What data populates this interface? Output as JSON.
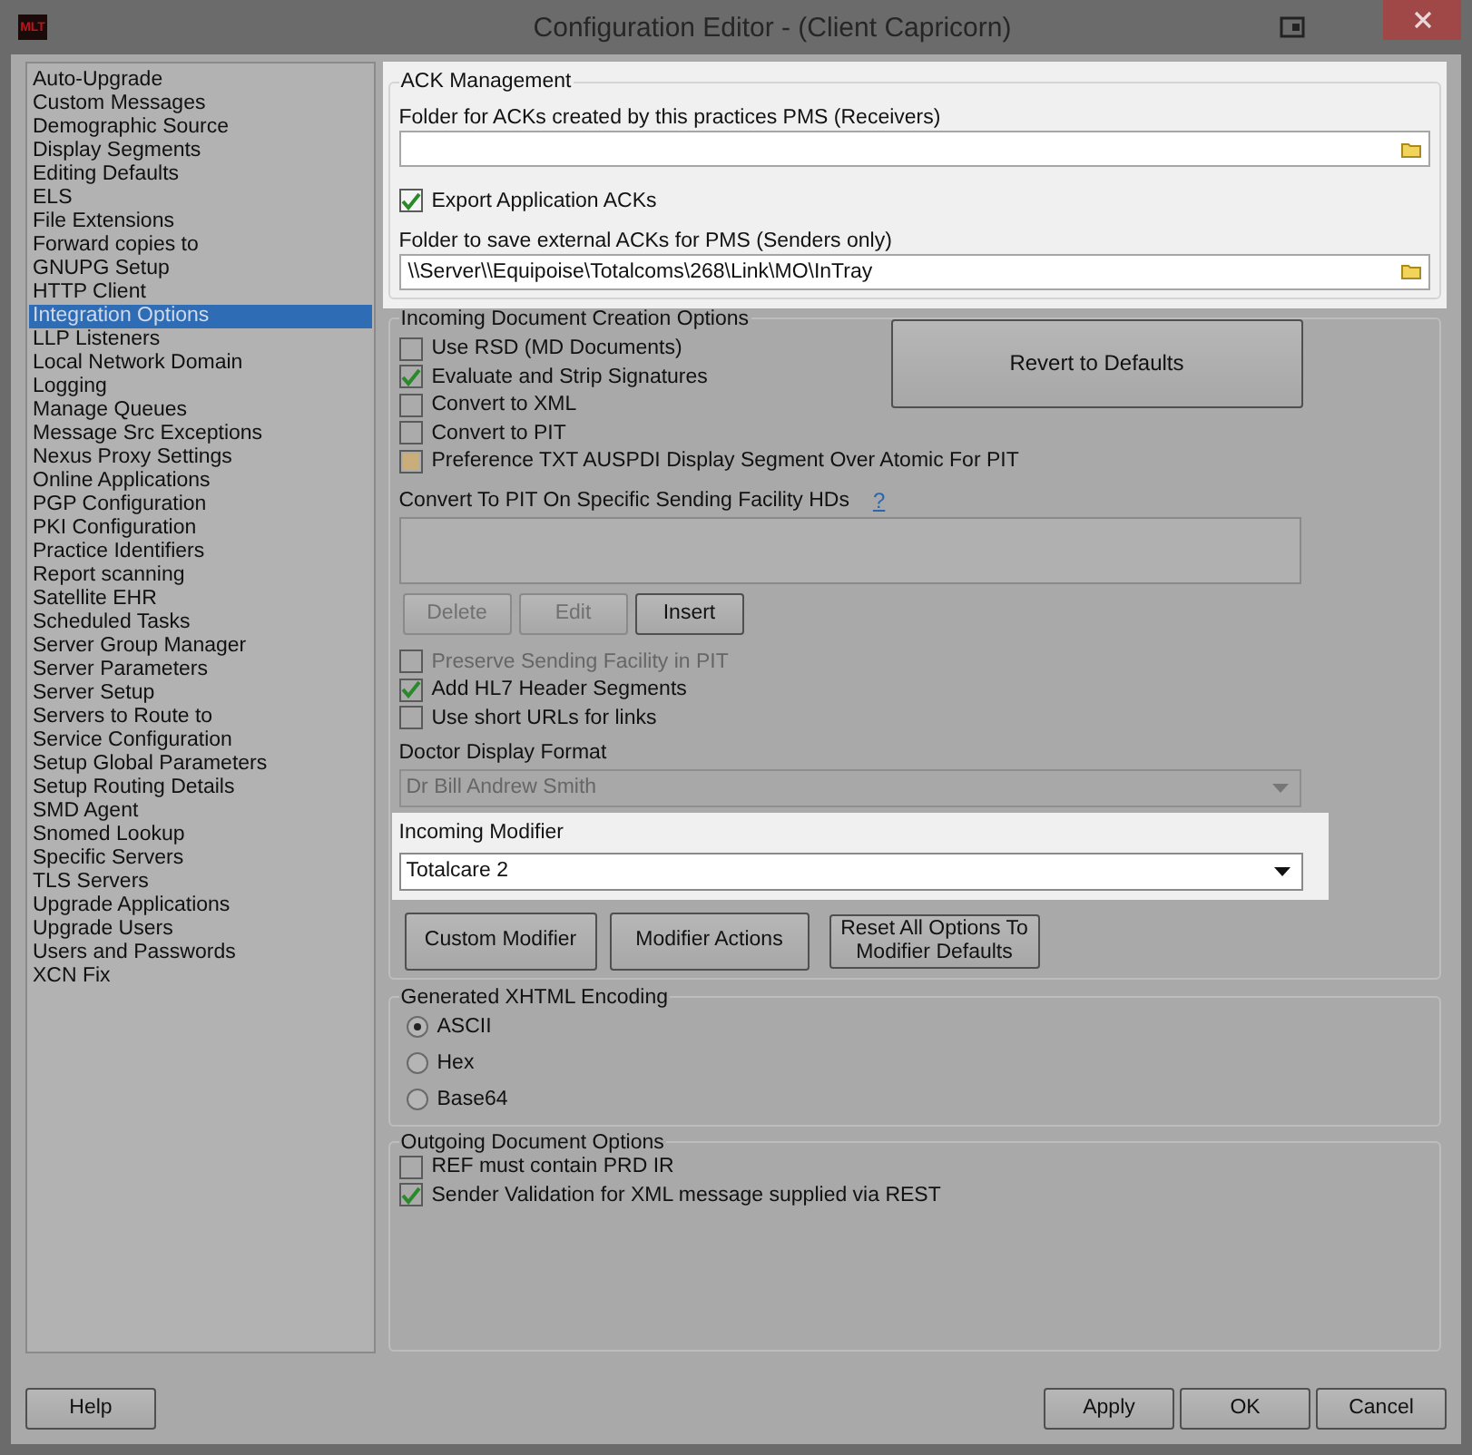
{
  "window": {
    "logo": "MLT",
    "title": "Configuration Editor -  (Client Capricorn)"
  },
  "sidebar": {
    "items": [
      {
        "label": "Auto-Upgrade",
        "selected": false
      },
      {
        "label": "Custom Messages",
        "selected": false
      },
      {
        "label": "Demographic Source",
        "selected": false
      },
      {
        "label": "Display Segments",
        "selected": false
      },
      {
        "label": "Editing Defaults",
        "selected": false
      },
      {
        "label": "ELS",
        "selected": false
      },
      {
        "label": "File Extensions",
        "selected": false
      },
      {
        "label": "Forward copies to",
        "selected": false
      },
      {
        "label": "GNUPG Setup",
        "selected": false
      },
      {
        "label": "HTTP Client",
        "selected": false
      },
      {
        "label": "Integration Options",
        "selected": true
      },
      {
        "label": "LLP Listeners",
        "selected": false
      },
      {
        "label": "Local Network Domain",
        "selected": false
      },
      {
        "label": "Logging",
        "selected": false
      },
      {
        "label": "Manage Queues",
        "selected": false
      },
      {
        "label": "Message Src Exceptions",
        "selected": false
      },
      {
        "label": "Nexus Proxy Settings",
        "selected": false
      },
      {
        "label": "Online Applications",
        "selected": false
      },
      {
        "label": "PGP Configuration",
        "selected": false
      },
      {
        "label": "PKI Configuration",
        "selected": false
      },
      {
        "label": "Practice Identifiers",
        "selected": false
      },
      {
        "label": "Report scanning",
        "selected": false
      },
      {
        "label": "Satellite EHR",
        "selected": false
      },
      {
        "label": "Scheduled Tasks",
        "selected": false
      },
      {
        "label": "Server Group Manager",
        "selected": false
      },
      {
        "label": "Server Parameters",
        "selected": false
      },
      {
        "label": "Server Setup",
        "selected": false
      },
      {
        "label": "Servers to Route to",
        "selected": false
      },
      {
        "label": "Service Configuration",
        "selected": false
      },
      {
        "label": "Setup Global Parameters",
        "selected": false
      },
      {
        "label": "Setup Routing Details",
        "selected": false
      },
      {
        "label": "SMD Agent",
        "selected": false
      },
      {
        "label": "Snomed Lookup",
        "selected": false
      },
      {
        "label": "Specific Servers",
        "selected": false
      },
      {
        "label": "TLS Servers",
        "selected": false
      },
      {
        "label": "Upgrade Applications",
        "selected": false
      },
      {
        "label": "Upgrade Users",
        "selected": false
      },
      {
        "label": "Users and Passwords",
        "selected": false
      },
      {
        "label": "XCN Fix",
        "selected": false
      }
    ]
  },
  "ack_management": {
    "highlighted": true,
    "title": "ACK Management",
    "receivers": {
      "label": "Folder for ACKs created by this practices PMS (Receivers)"
    },
    "export_acks": {
      "label": "Export Application ACKs",
      "checked": true
    },
    "senders": {
      "label": "Folder to save external ACKs for PMS (Senders only)",
      "value": "\\\\Server\\\\Equipoise\\Totalcoms\\268\\Link\\MO\\InTray"
    }
  },
  "incoming": {
    "title": "Incoming Document Creation Options",
    "options": [
      {
        "label": "Use RSD (MD Documents)",
        "checked": false,
        "tinted": false
      },
      {
        "label": "Evaluate and Strip Signatures",
        "checked": true,
        "tinted": false
      },
      {
        "label": "Convert to XML",
        "checked": false,
        "tinted": false
      },
      {
        "label": "Convert to PIT",
        "checked": false,
        "tinted": false
      },
      {
        "label": "Preference TXT AUSPDI Display Segment Over Atomic For PIT",
        "checked": false,
        "tinted": true
      }
    ],
    "revert_button": "Revert to Defaults",
    "facility_label": "Convert To PIT On Specific Sending Facility HDs",
    "help_link": "?",
    "list_buttons": [
      {
        "label": "Delete",
        "disabled": true
      },
      {
        "label": "Edit",
        "disabled": true
      },
      {
        "label": "Insert",
        "disabled": false
      }
    ],
    "more_options": [
      {
        "label": "Preserve Sending Facility in PIT",
        "checked": false,
        "disabled": true
      },
      {
        "label": "Add HL7 Header Segments",
        "checked": true,
        "disabled": false
      },
      {
        "label": "Use short URLs for links",
        "checked": false,
        "disabled": false
      }
    ],
    "doctor_format": {
      "label": "Doctor Display Format",
      "value": "Dr Bill Andrew Smith",
      "disabled": true
    },
    "incoming_modifier": {
      "label": "Incoming Modifier",
      "value": "Totalcare 2",
      "highlighted": true
    },
    "modifier_buttons": [
      "Custom Modifier",
      "Modifier Actions",
      "Reset All Options To Modifier Defaults"
    ]
  },
  "encoding": {
    "title": "Generated XHTML Encoding",
    "options": [
      {
        "label": "ASCII",
        "selected": true
      },
      {
        "label": "Hex",
        "selected": false
      },
      {
        "label": "Base64",
        "selected": false
      }
    ]
  },
  "outgoing": {
    "title": "Outgoing Document Options",
    "options": [
      {
        "label": "REF must contain PRD IR",
        "checked": false
      },
      {
        "label": "Sender Validation for XML message supplied via REST",
        "checked": true
      }
    ]
  },
  "footer": {
    "help": "Help",
    "actions": [
      "Apply",
      "OK",
      "Cancel"
    ]
  }
}
